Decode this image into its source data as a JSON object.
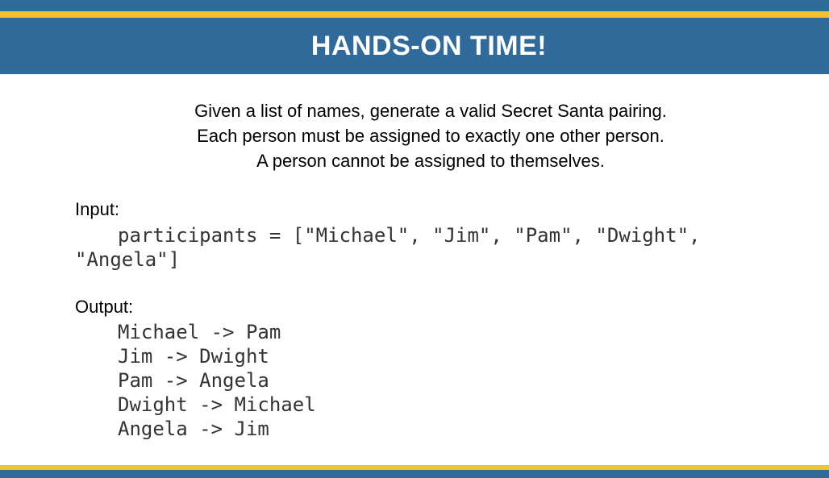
{
  "banner": {
    "title": "HANDS-ON TIME!"
  },
  "intro": {
    "lines": [
      "Given a list of names, generate a valid Secret Santa pairing.",
      "Each person must be assigned to exactly one other person.",
      "A person cannot be assigned to themselves."
    ]
  },
  "input": {
    "label": "Input:",
    "code_line_1": "participants = [\"Michael\", \"Jim\", \"Pam\", \"Dwight\",",
    "code_line_2": "\"Angela\"]"
  },
  "output": {
    "label": "Output:",
    "lines": [
      "Michael -> Pam",
      "Jim -> Dwight",
      "Pam -> Angela",
      "Dwight -> Michael",
      "Angela -> Jim"
    ]
  },
  "colors": {
    "banner_blue": "#306a9b",
    "accent_gold": "#f2c230"
  }
}
